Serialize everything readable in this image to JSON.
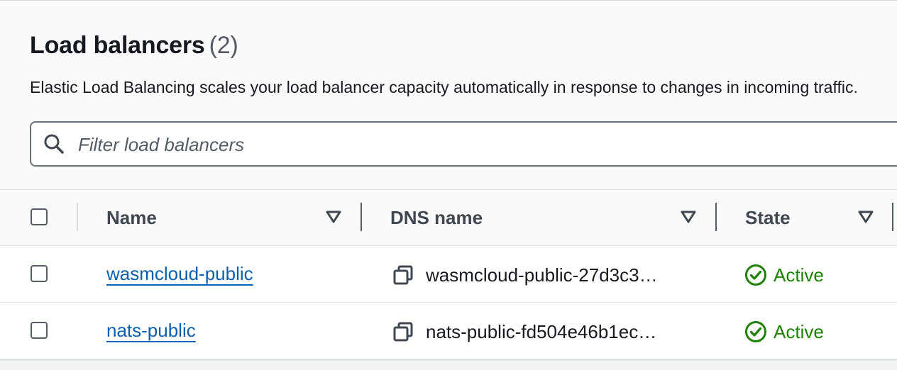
{
  "header": {
    "title": "Load balancers",
    "count": "(2)",
    "description": "Elastic Load Balancing scales your load balancer capacity automatically in response to changes in incoming traffic."
  },
  "filter": {
    "placeholder": "Filter load balancers",
    "value": "",
    "icon": "search-icon"
  },
  "table": {
    "columns": [
      {
        "label": "Name",
        "sortable": true
      },
      {
        "label": "DNS name",
        "sortable": true
      },
      {
        "label": "State",
        "sortable": true
      }
    ],
    "rows": [
      {
        "name": "wasmcloud-public",
        "dns_name": "wasmcloud-public-27d3c3…",
        "state": "Active",
        "selected": false
      },
      {
        "name": "nats-public",
        "dns_name": "nats-public-fd504e46b1ec…",
        "state": "Active",
        "selected": false
      }
    ]
  },
  "colors": {
    "link": "#0a5fb0",
    "active": "#1d8102",
    "text": "#16191f"
  }
}
